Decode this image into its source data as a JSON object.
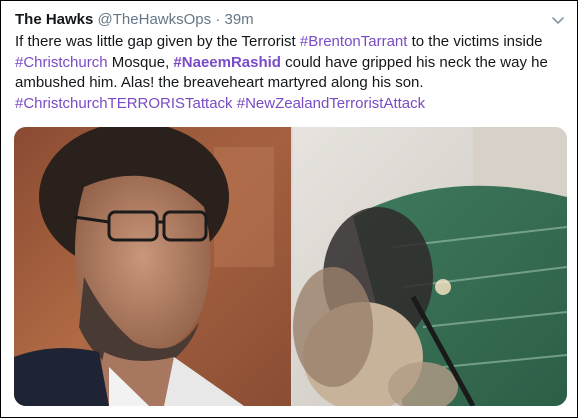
{
  "tweet": {
    "author_name": "The Hawks",
    "author_handle": "@TheHawksOps",
    "separator": "·",
    "time": "39m",
    "menu_icon": "chevron-down-icon",
    "text": {
      "p1": "If there was little gap given by the Terrorist ",
      "h1": "#BrentonTarrant",
      "p2": " to the victims inside ",
      "h2": "#Christchurch",
      "p3": " Mosque, ",
      "h3": "#NaeemRashid",
      "p4": " could have gripped his neck the way he ambushed him. Alas! the breaveheart martyred along his son. ",
      "h4": "#ChristchurchTERRORISTattack",
      "p5": " ",
      "h5": "#NewZealandTerroristAttack"
    },
    "colors": {
      "hashtag": "#794bc4",
      "text": "#14171a",
      "secondary": "#657786"
    }
  }
}
